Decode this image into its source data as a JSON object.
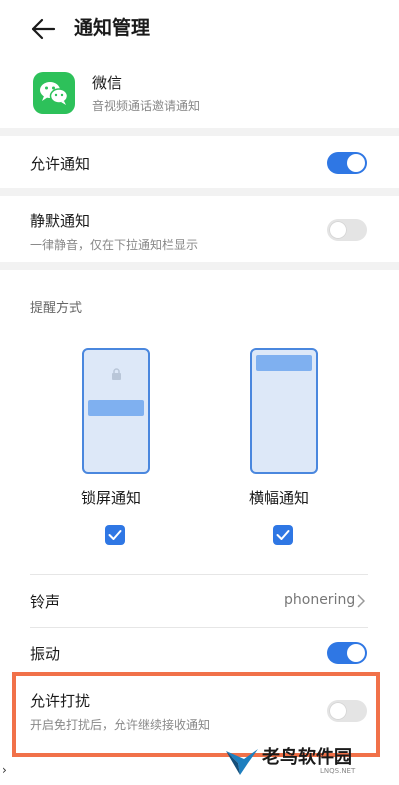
{
  "header": {
    "title": "通知管理",
    "back_icon": "arrow-left-icon"
  },
  "app": {
    "name": "微信",
    "description": "音视频通话邀请通知",
    "icon": "wechat-icon",
    "icon_color": "#2dc15a"
  },
  "settings": {
    "allow_notifications": {
      "label": "允许通知",
      "enabled": true
    },
    "silent_notifications": {
      "label": "静默通知",
      "description": "一律静音，仅在下拉通知栏显示",
      "enabled": false
    }
  },
  "reminder": {
    "section_label": "提醒方式",
    "options": [
      {
        "label": "锁屏通知",
        "checked": true,
        "icon": "lock-icon"
      },
      {
        "label": "横幅通知",
        "checked": true
      }
    ]
  },
  "ringtone": {
    "label": "铃声",
    "value": "phonering"
  },
  "vibration": {
    "label": "振动",
    "enabled": true
  },
  "do_not_disturb": {
    "label": "允许打扰",
    "description": "开启免打扰后，允许继续接收通知",
    "enabled": false
  },
  "watermark": {
    "text": "老鸟软件园",
    "sub": "LNQS.NET"
  },
  "colors": {
    "accent": "#2f77e4",
    "highlight": "#f17149",
    "toggle_off": "#e4e4e4"
  }
}
